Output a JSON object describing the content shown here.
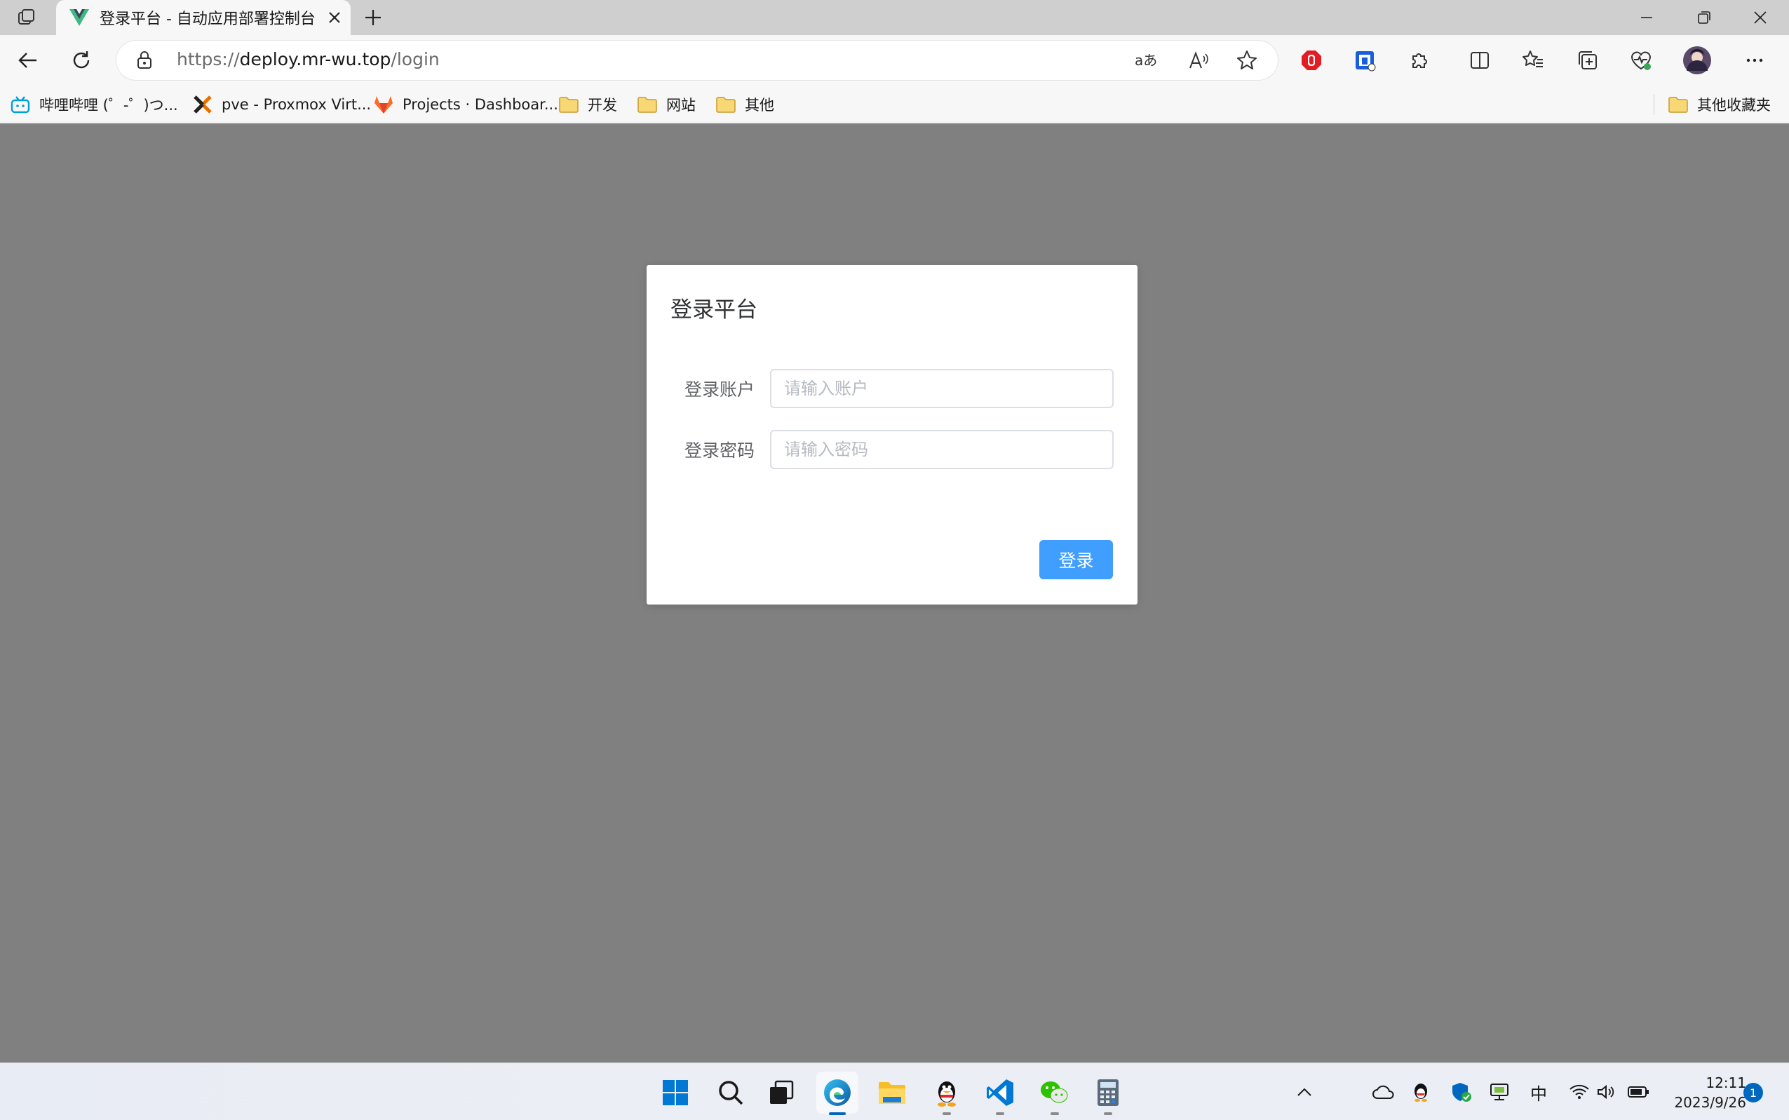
{
  "browser": {
    "tab": {
      "title": "登录平台 - 自动应用部署控制台",
      "favicon": "vue-icon"
    },
    "address": {
      "scheme": "https://",
      "host": "deploy.mr-wu.top",
      "path": "/login"
    },
    "favorites": [
      {
        "label": "哔哩哔哩 (゜-゜)つ...",
        "icon": "bilibili-icon"
      },
      {
        "label": "pve - Proxmox Virt...",
        "icon": "proxmox-icon"
      },
      {
        "label": "Projects · Dashboar...",
        "icon": "gitlab-icon"
      },
      {
        "label": "开发",
        "icon": "folder-icon"
      },
      {
        "label": "网站",
        "icon": "folder-icon"
      },
      {
        "label": "其他",
        "icon": "folder-icon"
      }
    ],
    "other_favorites": "其他收藏夹"
  },
  "login": {
    "title": "登录平台",
    "account_label": "登录账户",
    "account_placeholder": "请输入账户",
    "password_label": "登录密码",
    "password_placeholder": "请输入密码",
    "submit_label": "登录"
  },
  "taskbar": {
    "ime": "中",
    "time": "12:11",
    "date": "2023/9/26",
    "notifications": "1"
  },
  "colors": {
    "primary": "#409eff",
    "overlay": "#808080",
    "edge_accent": "#0067c0"
  }
}
